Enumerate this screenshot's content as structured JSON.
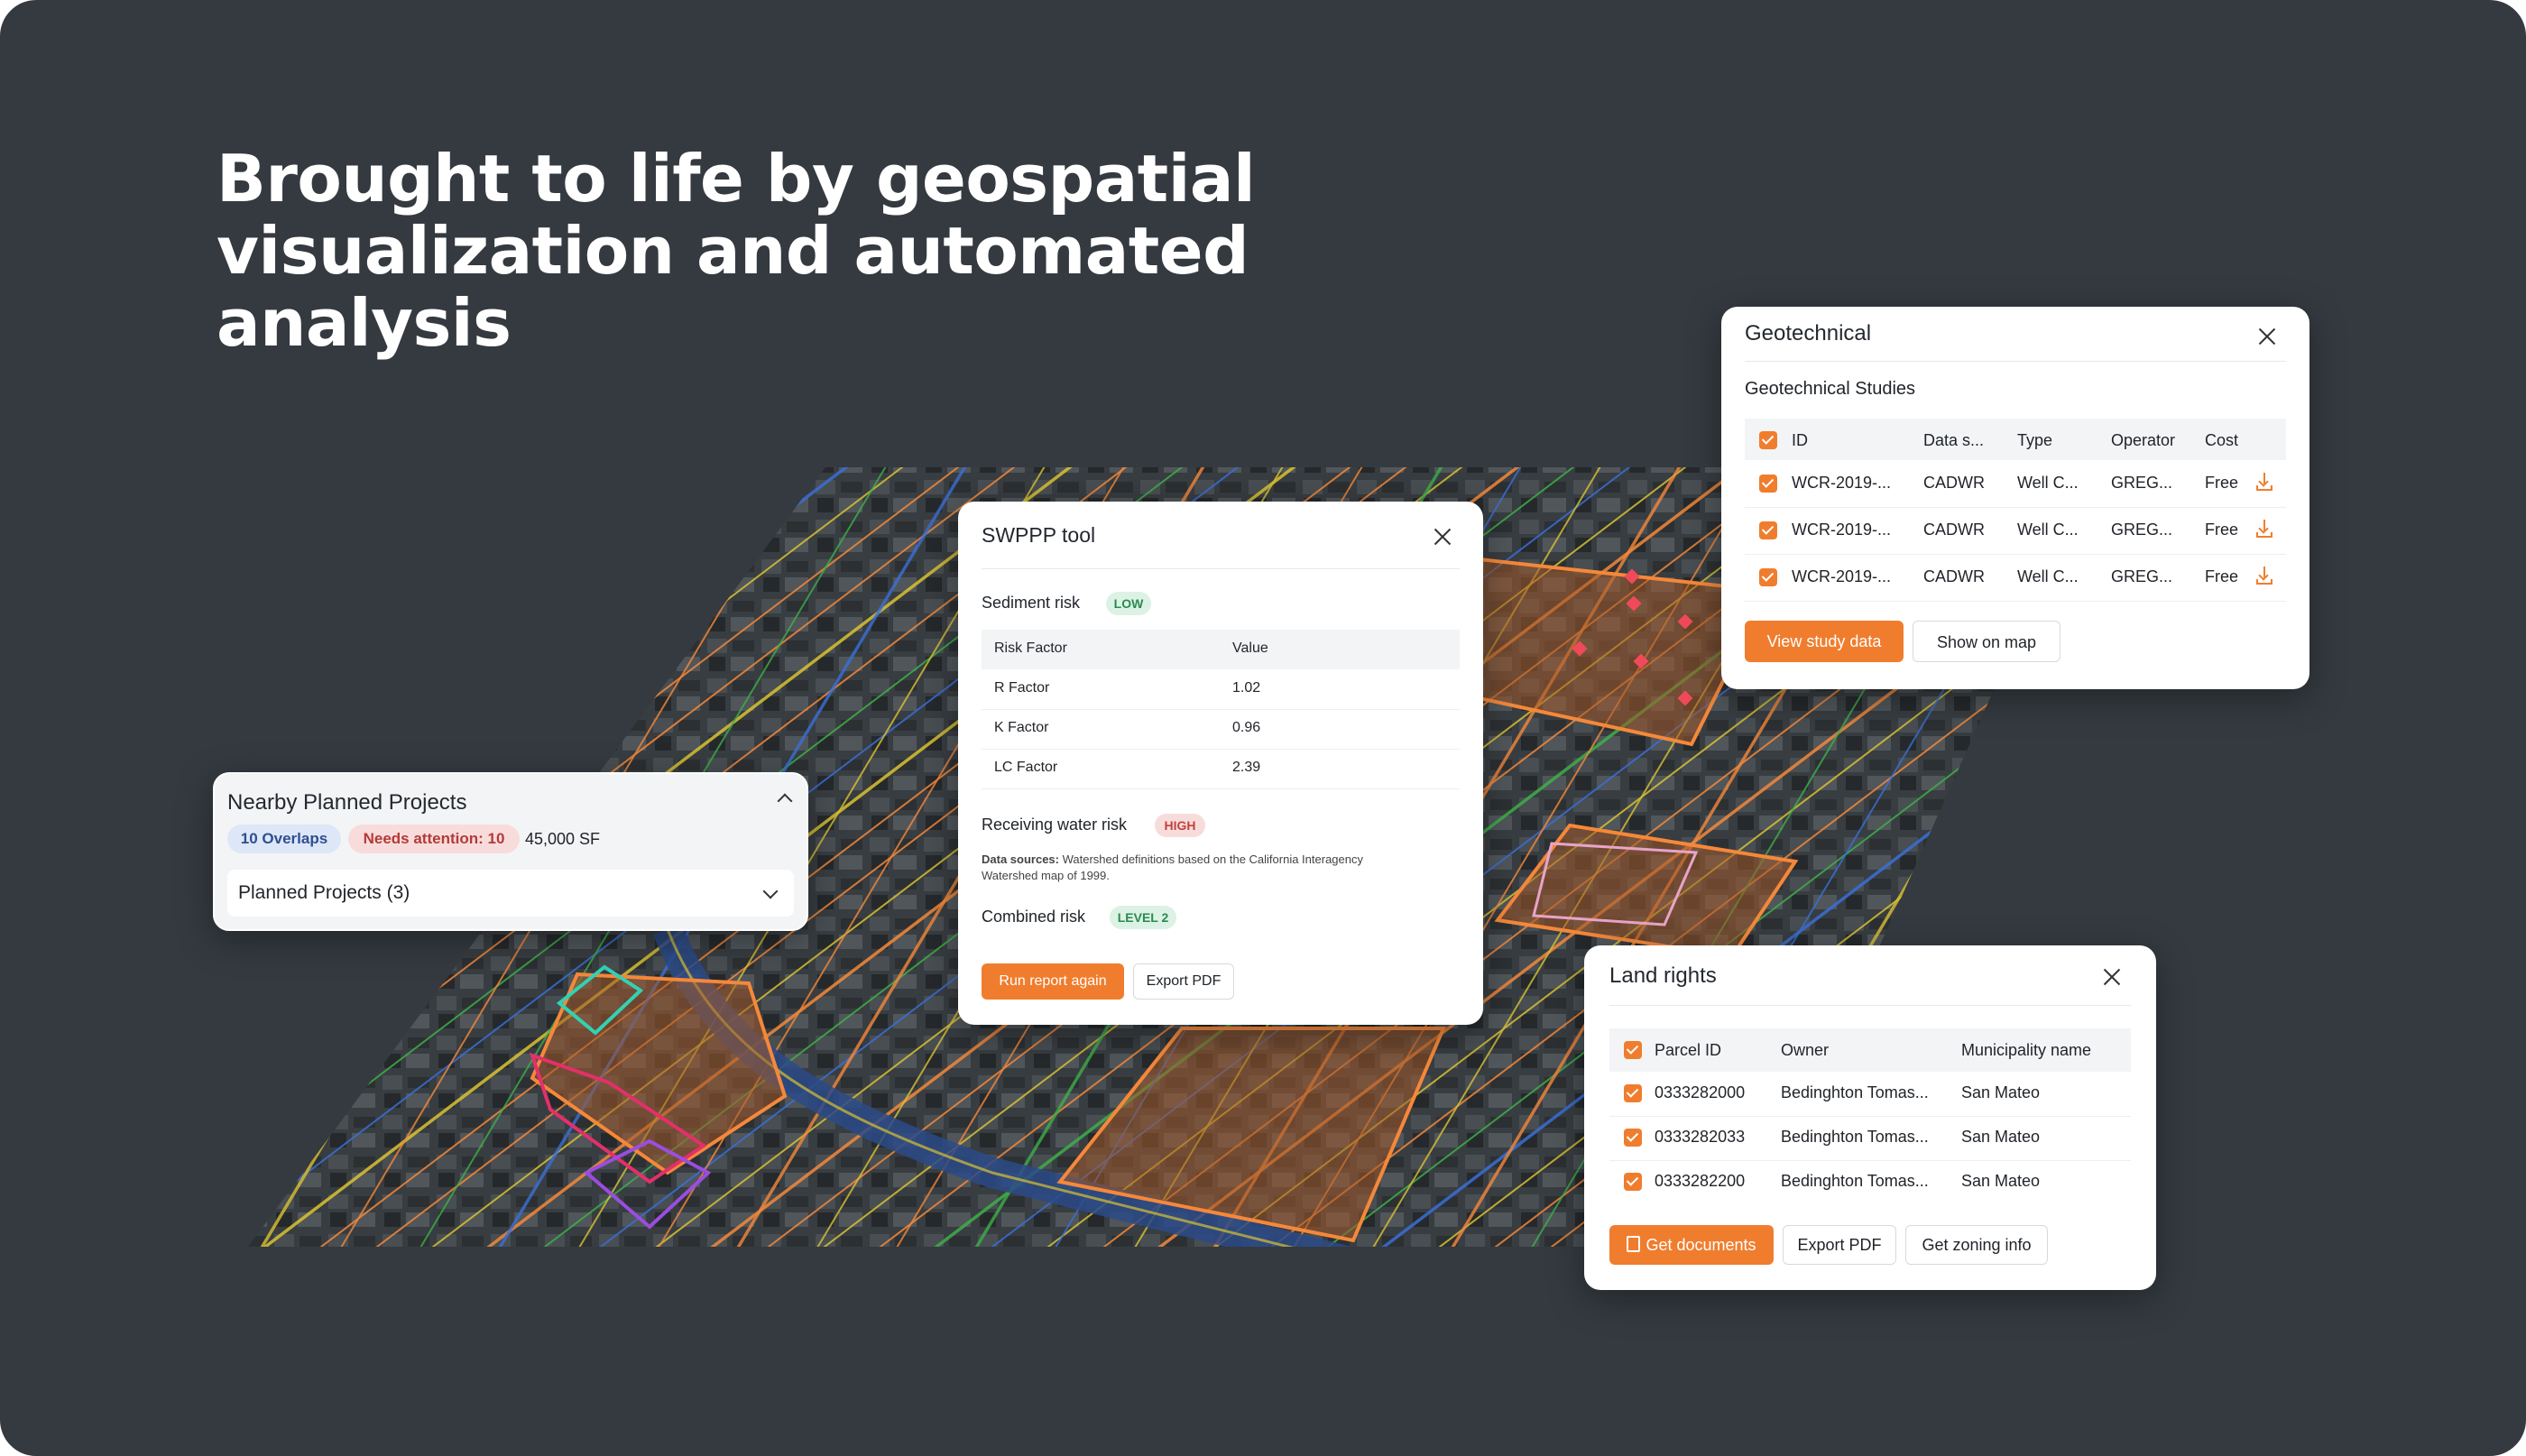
{
  "headline": {
    "line1": "Brought to life by geospatial",
    "line2": "visualization and automated",
    "line3": "analysis"
  },
  "geotechnical": {
    "title": "Geotechnical",
    "subtitle": "Geotechnical Studies",
    "columns": [
      "ID",
      "Data s...",
      "Type",
      "Operator",
      "Cost"
    ],
    "rows": [
      {
        "id": "WCR-2019-...",
        "source": "CADWR",
        "type": "Well C...",
        "operator": "GREG...",
        "cost": "Free"
      },
      {
        "id": "WCR-2019-...",
        "source": "CADWR",
        "type": "Well C...",
        "operator": "GREG...",
        "cost": "Free"
      },
      {
        "id": "WCR-2019-...",
        "source": "CADWR",
        "type": "Well C...",
        "operator": "GREG...",
        "cost": "Free"
      }
    ],
    "view_button": "View study data",
    "map_button": "Show on map"
  },
  "swppp": {
    "title": "SWPPP tool",
    "sediment_label": "Sediment risk",
    "sediment_badge": "LOW",
    "table_headers": [
      "Risk Factor",
      "Value"
    ],
    "factors": [
      {
        "name": "R Factor",
        "value": "1.02"
      },
      {
        "name": "K Factor",
        "value": "0.96"
      },
      {
        "name": "LC Factor",
        "value": "2.39"
      }
    ],
    "water_label": "Receiving water risk",
    "water_badge": "HIGH",
    "sources_label": "Data sources:",
    "sources_line1": "Watershed definitions based on the California Interagency",
    "sources_line2": "Watershed map of 1999.",
    "combined_label": "Combined risk",
    "combined_badge": "LEVEL 2",
    "run_button": "Run report again",
    "export_button": "Export PDF"
  },
  "nearby": {
    "title": "Nearby Planned Projects",
    "overlaps": "10 Overlaps",
    "attention": "Needs attention: 10",
    "area": "45,000 SF",
    "dropdown": "Planned Projects (3)"
  },
  "land": {
    "title": "Land rights",
    "columns": [
      "Parcel ID",
      "Owner",
      "Municipality name"
    ],
    "rows": [
      {
        "parcel": "0333282000",
        "owner": "Bedinghton Tomas...",
        "municipality": "San Mateo"
      },
      {
        "parcel": "0333282033",
        "owner": "Bedinghton Tomas...",
        "municipality": "San Mateo"
      },
      {
        "parcel": "0333282200",
        "owner": "Bedinghton Tomas...",
        "municipality": "San Mateo"
      }
    ],
    "docs_button": "Get documents",
    "export_button": "Export PDF",
    "zoning_button": "Get zoning info"
  },
  "colors": {
    "background": "#343a40",
    "accent": "#f07d2e",
    "overlay_orange": "#f5883a",
    "overlay_yellow": "#d9c233",
    "overlay_green": "#3fae49",
    "overlay_blue": "#3b6fd6",
    "badge_blue_bg": "#dde7f7",
    "badge_red_bg": "#f8dcdc",
    "badge_green_bg": "#dcf2e4"
  },
  "icons": [
    "close-icon",
    "chevron-up-icon",
    "chevron-down-icon",
    "download-icon",
    "document-icon",
    "checkbox-checked-icon"
  ]
}
